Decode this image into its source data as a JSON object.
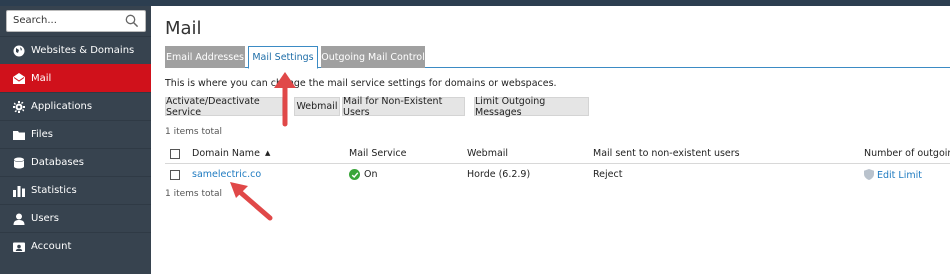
{
  "sidebar": {
    "search_placeholder": "Search...",
    "items": [
      {
        "label": "Websites & Domains",
        "icon": "globe-icon"
      },
      {
        "label": "Mail",
        "icon": "envelope-icon"
      },
      {
        "label": "Applications",
        "icon": "gear-icon"
      },
      {
        "label": "Files",
        "icon": "folder-icon"
      },
      {
        "label": "Databases",
        "icon": "database-icon"
      },
      {
        "label": "Statistics",
        "icon": "bar-chart-icon"
      },
      {
        "label": "Users",
        "icon": "user-icon"
      },
      {
        "label": "Account",
        "icon": "account-card-icon"
      }
    ],
    "active_index": 1,
    "active_color": "#d0111b"
  },
  "main": {
    "title": "Mail",
    "tabs": [
      {
        "label": "Email Addresses"
      },
      {
        "label": "Mail Settings",
        "active": true
      },
      {
        "label": "Outgoing Mail Control"
      }
    ],
    "description": "This is where you can change the mail service settings for domains or webspaces.",
    "toolbar": [
      {
        "label": "Activate/Deactivate Service"
      },
      {
        "label": "Webmail"
      },
      {
        "label": "Mail for Non-Existent Users"
      },
      {
        "label": "Limit Outgoing Messages"
      }
    ],
    "items_total": "1 items total",
    "table": {
      "columns": [
        "Domain Name",
        "Mail Service",
        "Webmail",
        "Mail sent to non-existent users",
        "Number of outgoing"
      ],
      "sort_indicator": "▲",
      "rows": [
        {
          "domain": "samelectric.co",
          "mail_service": "On",
          "webmail": "Horde (6.2.9)",
          "non_existent": "Reject",
          "outgoing": "Edit Limit"
        }
      ]
    },
    "items_total_bottom": "1 items total"
  },
  "colors": {
    "link": "#1f7bc1",
    "arrow": "#e04848",
    "tab_border": "#3b8bc4"
  }
}
